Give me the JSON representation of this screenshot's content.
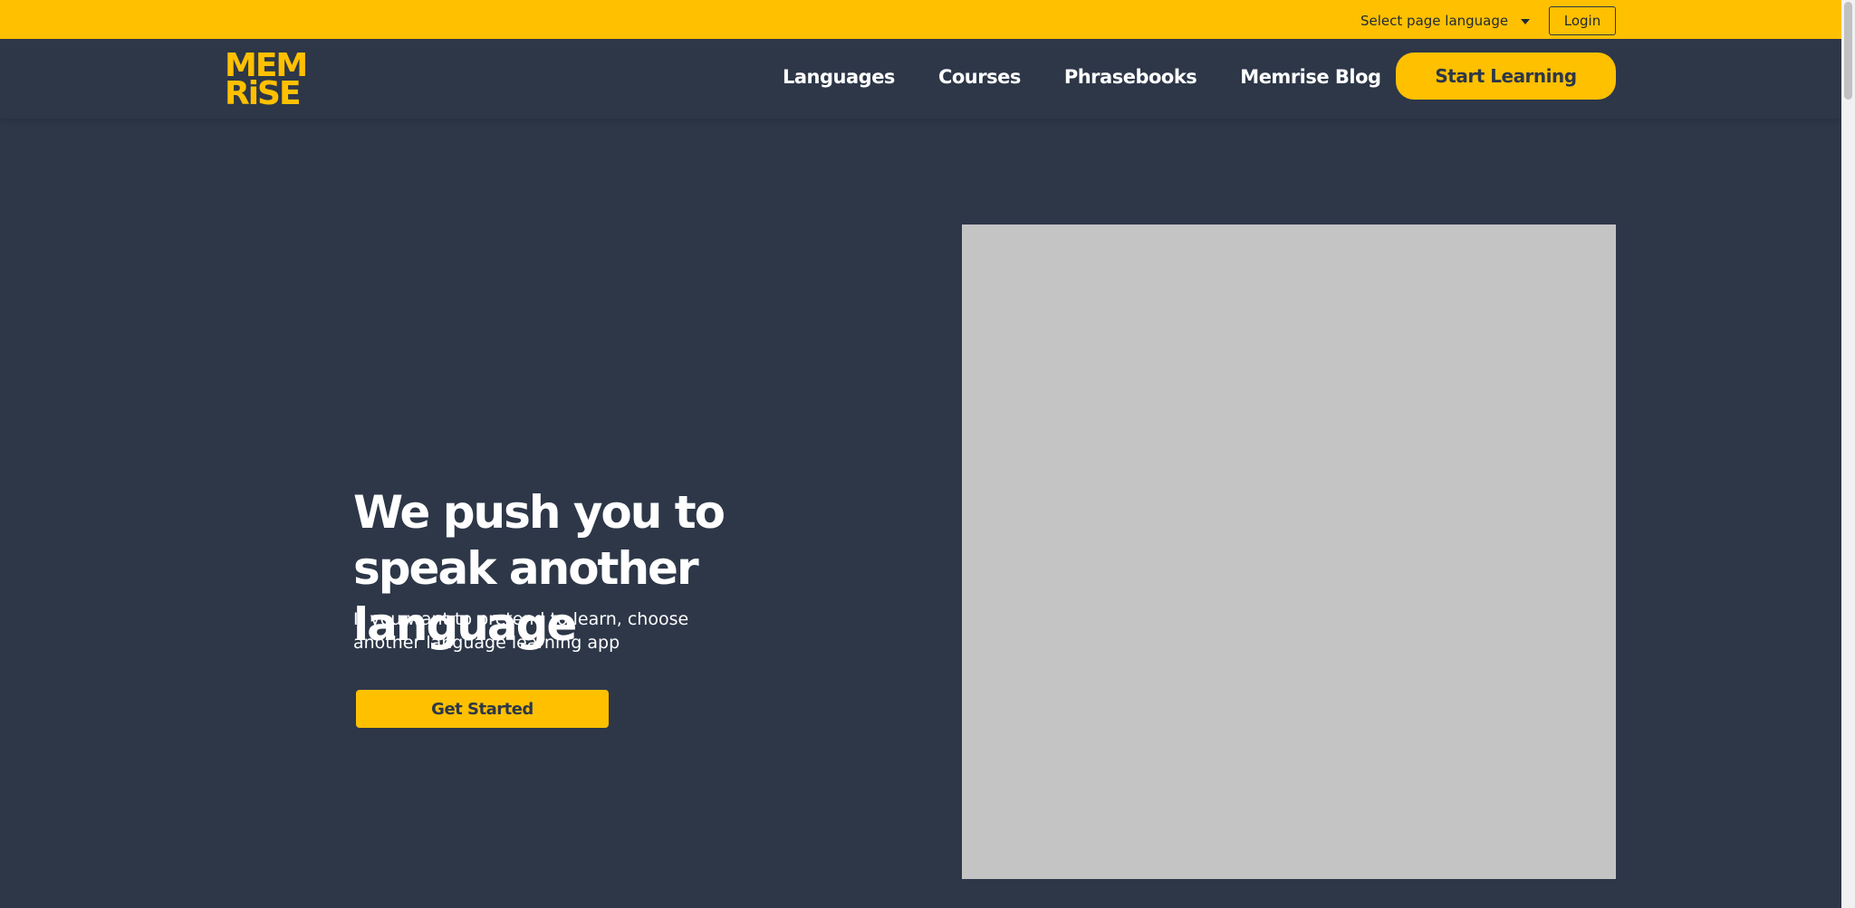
{
  "topbar": {
    "language_select_label": "Select page language",
    "login_label": "Login"
  },
  "navbar": {
    "logo_line1": "MEM",
    "logo_line2": "RiSE",
    "links": [
      {
        "label": "Languages"
      },
      {
        "label": "Courses"
      },
      {
        "label": "Phrasebooks"
      },
      {
        "label": "Memrise Blog"
      }
    ],
    "start_learning_label": "Start Learning"
  },
  "hero": {
    "title": "We push you to speak another language",
    "subtitle": "If you want to pretend to learn, choose another language learning app",
    "cta_label": "Get Started"
  },
  "colors": {
    "brand_yellow": "#ffc000",
    "background_navy": "#2d3748",
    "image_placeholder": "#c4c4c4"
  }
}
